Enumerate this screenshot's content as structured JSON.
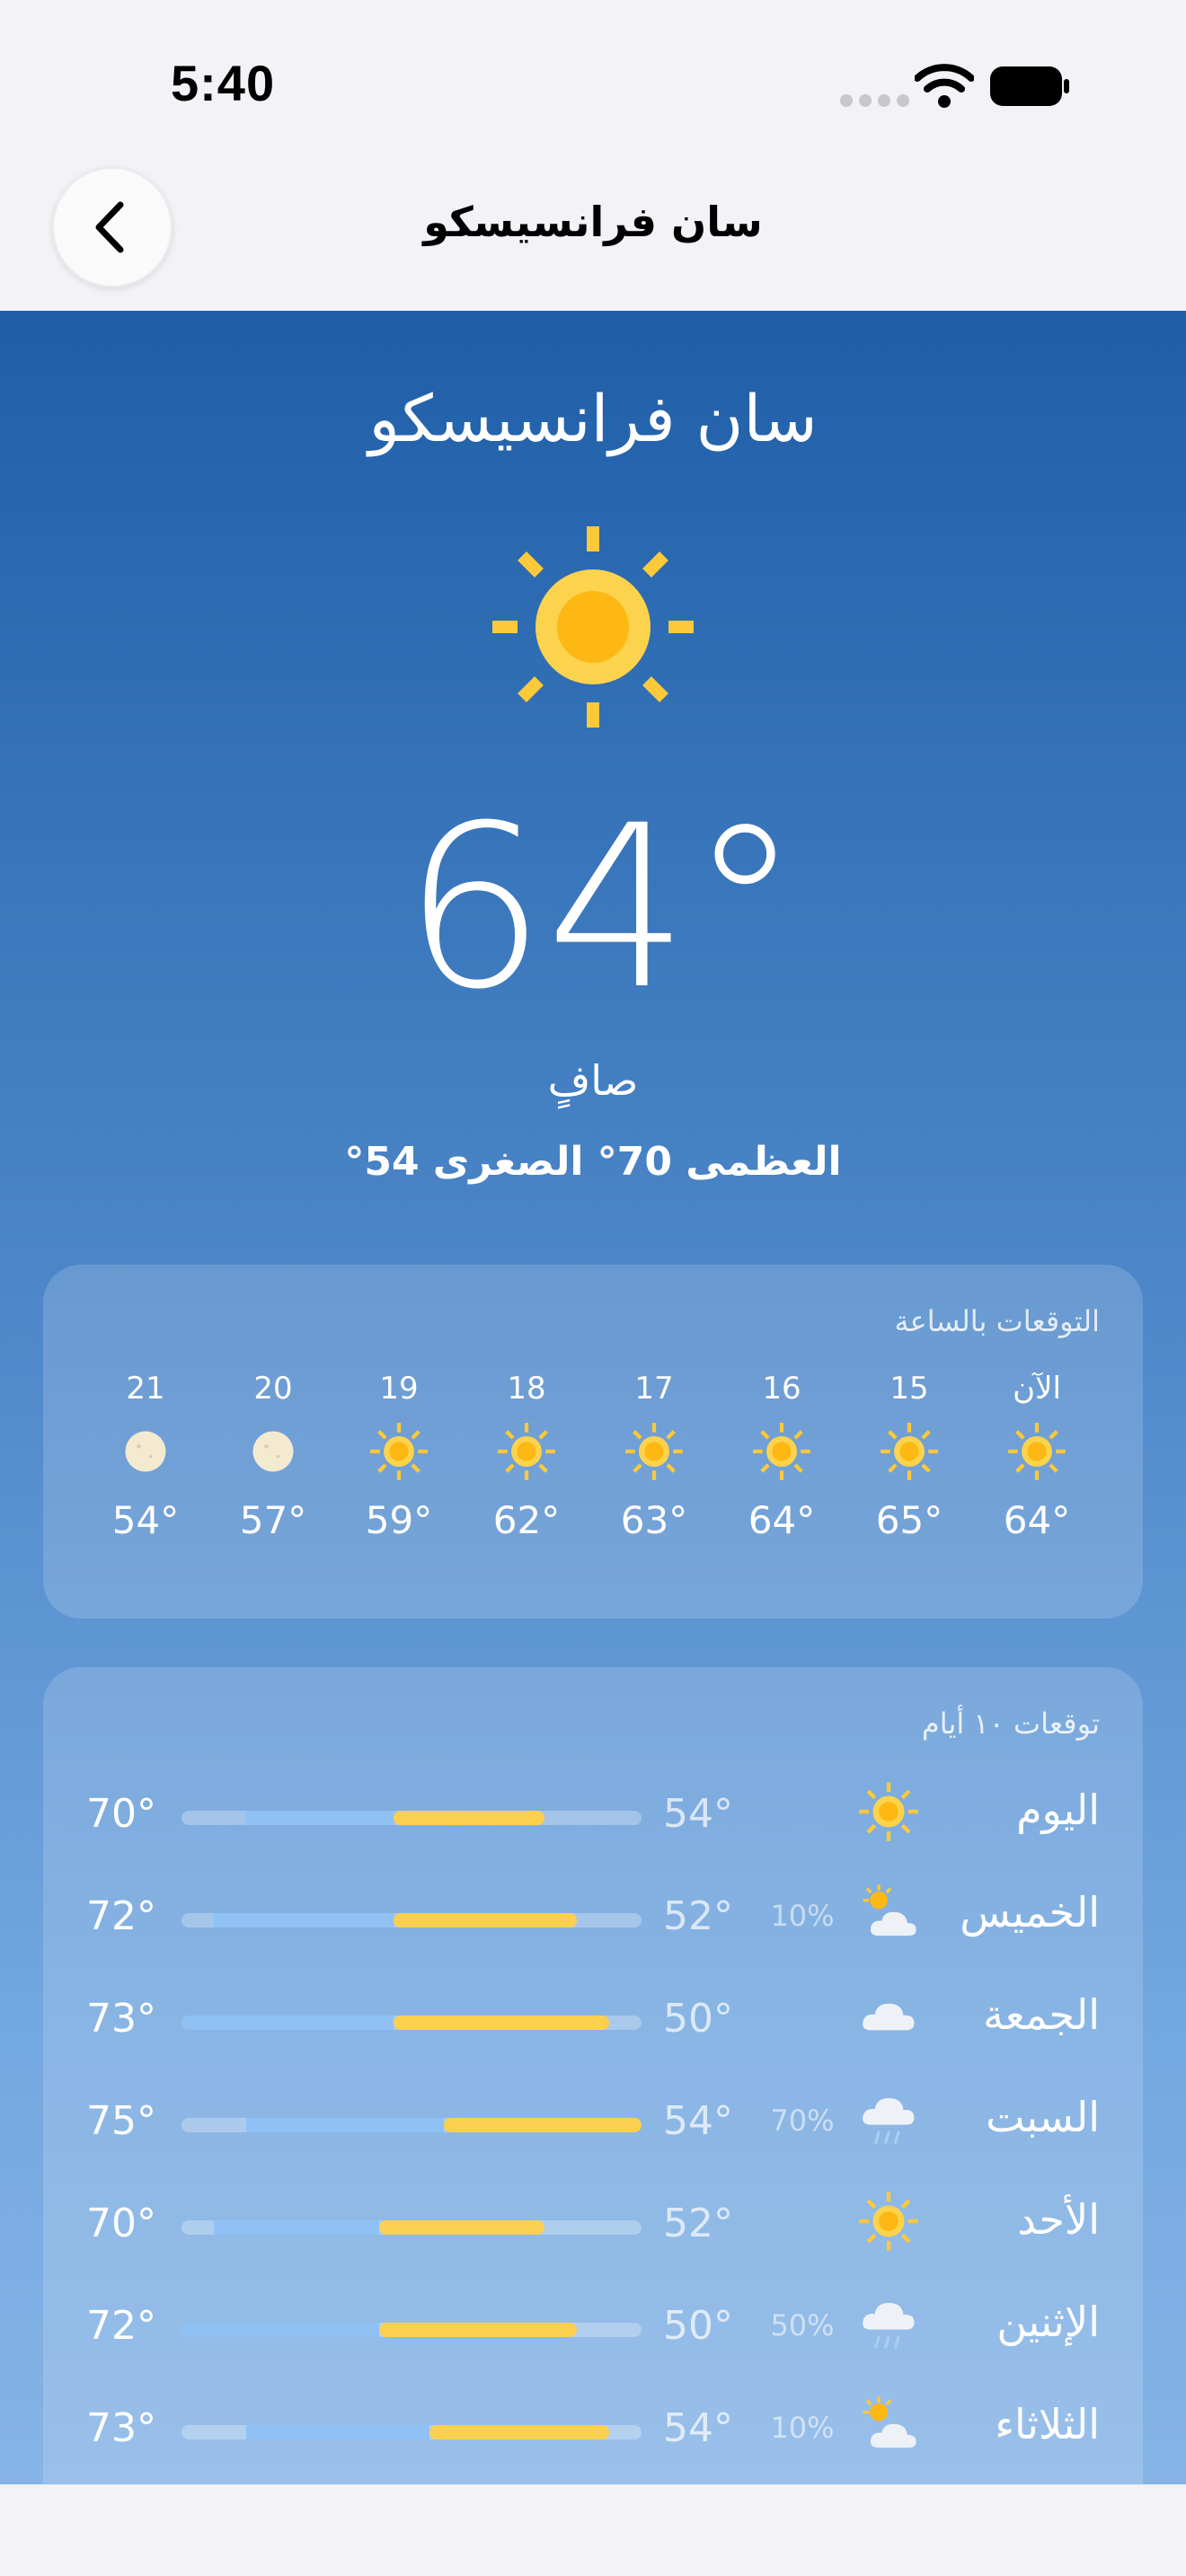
{
  "status_bar": {
    "time": "5:40"
  },
  "nav": {
    "title": "سان فرانسيسكو",
    "back_icon": "chevron-left-icon"
  },
  "current": {
    "city": "سان فرانسيسكو",
    "icon": "sun-icon",
    "temperature": "64°",
    "condition": "صافٍ",
    "high_low": "العظمى 70° الصغرى 54°"
  },
  "hourly": {
    "title": "التوقعات بالساعة",
    "items": [
      {
        "label": "الآن",
        "icon": "sun-icon",
        "temp": "64°"
      },
      {
        "label": "15",
        "icon": "sun-icon",
        "temp": "65°"
      },
      {
        "label": "16",
        "icon": "sun-icon",
        "temp": "64°"
      },
      {
        "label": "17",
        "icon": "sun-icon",
        "temp": "63°"
      },
      {
        "label": "18",
        "icon": "sun-icon",
        "temp": "62°"
      },
      {
        "label": "19",
        "icon": "sun-icon",
        "temp": "59°"
      },
      {
        "label": "20",
        "icon": "moon-icon",
        "temp": "57°"
      },
      {
        "label": "21",
        "icon": "moon-icon",
        "temp": "54°"
      }
    ]
  },
  "daily": {
    "title": "توقعات ١٠ أيام",
    "items": [
      {
        "day": "اليوم",
        "icon": "sun-icon",
        "precip": "",
        "low": "54°",
        "high": "70°",
        "range_start": 0.14,
        "range_split": 0.46,
        "range_end": 0.79
      },
      {
        "day": "الخميس",
        "icon": "partly-cloudy-icon",
        "precip": "10%",
        "low": "52°",
        "high": "72°",
        "range_start": 0.07,
        "range_split": 0.46,
        "range_end": 0.86
      },
      {
        "day": "الجمعة",
        "icon": "cloud-icon",
        "precip": "",
        "low": "50°",
        "high": "73°",
        "range_start": 0.0,
        "range_split": 0.46,
        "range_end": 0.93
      },
      {
        "day": "السبت",
        "icon": "rain-icon",
        "precip": "70%",
        "low": "54°",
        "high": "75°",
        "range_start": 0.14,
        "range_split": 0.57,
        "range_end": 1.0
      },
      {
        "day": "الأحد",
        "icon": "sun-icon",
        "precip": "",
        "low": "52°",
        "high": "70°",
        "range_start": 0.07,
        "range_split": 0.43,
        "range_end": 0.79
      },
      {
        "day": "الإثنين",
        "icon": "rain-icon",
        "precip": "50%",
        "low": "50°",
        "high": "72°",
        "range_start": 0.0,
        "range_split": 0.43,
        "range_end": 0.86
      },
      {
        "day": "الثلاثاء",
        "icon": "partly-cloudy-icon",
        "precip": "10%",
        "low": "54°",
        "high": "73°",
        "range_start": 0.14,
        "range_split": 0.54,
        "range_end": 0.93
      }
    ]
  },
  "colors": {
    "sun": "#fcc93a",
    "sun_core": "#fdb813",
    "moon": "#f3ead0",
    "bar_blue": "#8fc1f5",
    "bar_yellow": "#fcd04f"
  }
}
